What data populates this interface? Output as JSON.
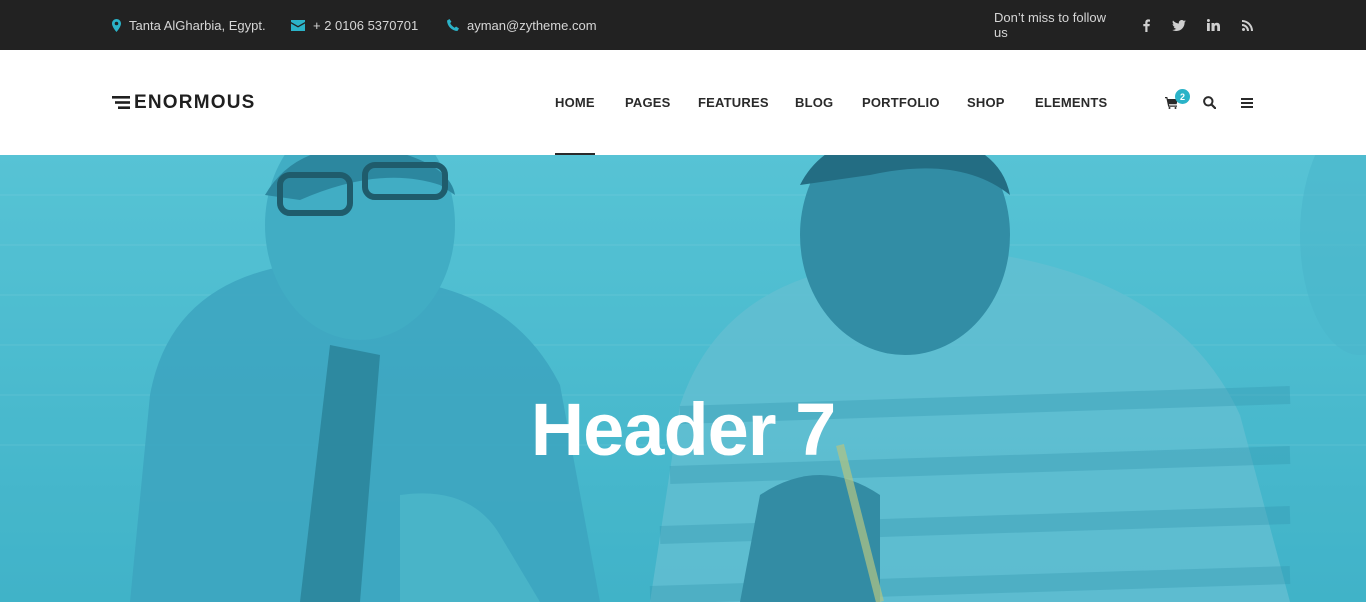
{
  "topbar": {
    "address": "Tanta AlGharbia, Egypt.",
    "phone": "+ 2 0106 5370701",
    "email": "ayman@zytheme.com",
    "follow_text": "Don’t miss to follow us",
    "social_icons": [
      "facebook-icon",
      "twitter-icon",
      "linkedin-icon",
      "rss-icon"
    ]
  },
  "brand": {
    "name": "ENORMOUS"
  },
  "nav": {
    "items": [
      {
        "label": "HOME",
        "active": true
      },
      {
        "label": "PAGES"
      },
      {
        "label": "FEATURES"
      },
      {
        "label": "BLOG"
      },
      {
        "label": "PORTFOLIO"
      },
      {
        "label": "SHOP"
      },
      {
        "label": "ELEMENTS"
      }
    ],
    "cart_count": "2"
  },
  "hero": {
    "title": "Header 7"
  },
  "colors": {
    "accent": "#2bb3c8",
    "topbar_bg": "#222222",
    "hero_tint": "#4fbdd0"
  }
}
